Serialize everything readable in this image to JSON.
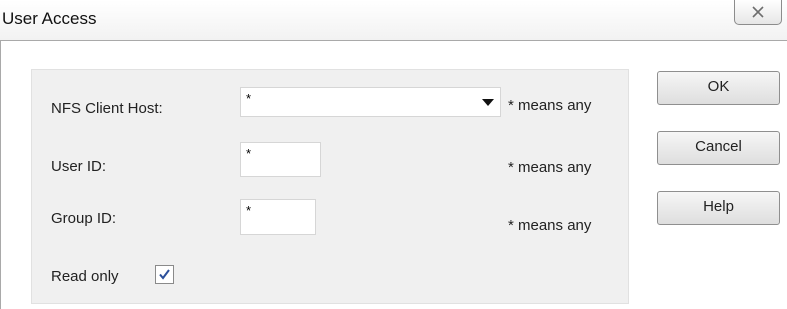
{
  "window": {
    "title": "User Access"
  },
  "form": {
    "nfs_host": {
      "label": "NFS Client Host:",
      "value": "*",
      "hint": "* means any"
    },
    "user_id": {
      "label": "User ID:",
      "value": "*",
      "hint": "* means any"
    },
    "group_id": {
      "label": "Group ID:",
      "value": "*",
      "hint": "* means any"
    },
    "read_only": {
      "label": "Read only",
      "checked": true
    }
  },
  "buttons": {
    "ok": "OK",
    "cancel": "Cancel",
    "help": "Help"
  },
  "icons": {
    "close": "close-icon",
    "checkmark": "checkmark-icon",
    "dropdown": "chevron-down-icon"
  },
  "colors": {
    "panel_bg": "#f0f0f0",
    "checkmark": "#2b4f9b"
  }
}
